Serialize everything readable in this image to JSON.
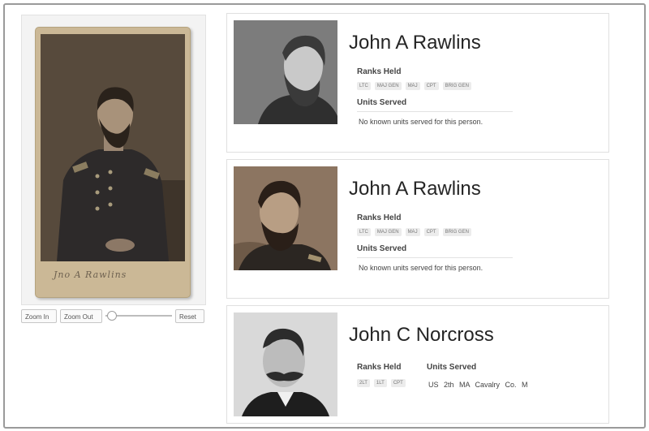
{
  "viewer": {
    "signature": "Jno A Rawlins",
    "zoom_in": "Zoom In",
    "zoom_out": "Zoom Out",
    "reset": "Reset",
    "zoom_level": 0.05
  },
  "results": [
    {
      "name": "John A Rawlins",
      "ranks_label": "Ranks Held",
      "ranks": [
        "LTC",
        "MAJ GEN",
        "MAJ",
        "CPT",
        "BRIG GEN"
      ],
      "units_label": "Units Served",
      "units_note": "No known units served for this person."
    },
    {
      "name": "John A Rawlins",
      "ranks_label": "Ranks Held",
      "ranks": [
        "LTC",
        "MAJ GEN",
        "MAJ",
        "CPT",
        "BRIG GEN"
      ],
      "units_label": "Units Served",
      "units_note": "No known units served for this person."
    },
    {
      "name": "John C Norcross",
      "ranks_label": "Ranks Held",
      "ranks": [
        "2LT",
        "1LT",
        "CPT"
      ],
      "units_label": "Units Served",
      "units_value": "US 2th MA Cavalry Co. M"
    }
  ],
  "colors": {
    "photo_sepia": "#5e5243",
    "mount": "#cbb896",
    "tag_bg": "#ececec"
  }
}
